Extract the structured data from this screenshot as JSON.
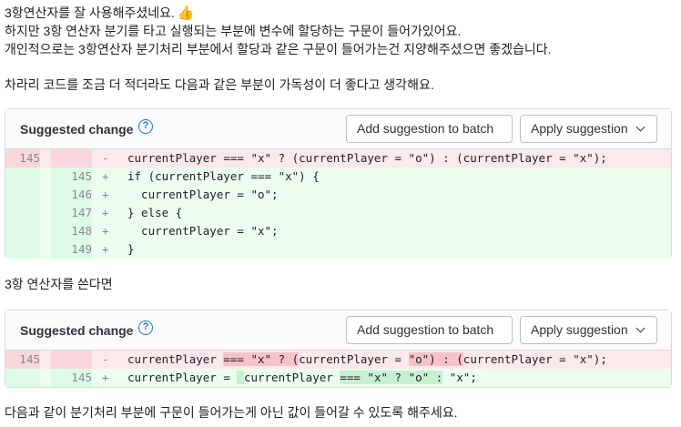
{
  "comment1": {
    "lines": [
      "3항연산자를 잘 사용해주셨네요.",
      "하지만 3항 연산자 분기를 타고 실행되는 부분에 변수에 할당하는 구문이 들어가있어요.",
      "개인적으로는 3항연산자 분기처리 부분에서 할당과 같은 구문이 들어가는건 지양해주셨으면 좋겠습니다.",
      "차라리 코드를 조금 더 적더라도 다음과 같은 부분이 가독성이 더 좋다고 생각해요."
    ],
    "emoji_icon": "thumbs-up-icon"
  },
  "suggestion_ui": {
    "title": "Suggested change",
    "help_label": "?",
    "add_batch_label": "Add suggestion to batch",
    "apply_label": "Apply suggestion"
  },
  "suggestion1": {
    "old_line": {
      "num": "145",
      "sign": "-",
      "code": "currentPlayer === \"x\" ? (currentPlayer = \"o\") : (currentPlayer = \"x\");"
    },
    "new_lines": [
      {
        "num": "145",
        "sign": "+",
        "code": "if (currentPlayer === \"x\") {"
      },
      {
        "num": "146",
        "sign": "+",
        "code": "  currentPlayer = \"o\";"
      },
      {
        "num": "147",
        "sign": "+",
        "code": "} else {"
      },
      {
        "num": "148",
        "sign": "+",
        "code": "  currentPlayer = \"x\";"
      },
      {
        "num": "149",
        "sign": "+",
        "code": "}"
      }
    ]
  },
  "comment2": {
    "text": "3항 연산자를 쓴다면"
  },
  "suggestion2": {
    "old_line": {
      "num": "145",
      "sign": "-",
      "parts": [
        "currentPlayer ",
        "=== \"x\" ? (",
        "currentPlayer = ",
        "\"o\") : (",
        "currentPlayer = ",
        "\"x\")",
        ";"
      ]
    },
    "new_line": {
      "num": "145",
      "sign": "+",
      "parts": [
        "currentPlayer = ",
        " ",
        "currentPlayer ",
        "===",
        " \"x\" ? \"o\" ",
        ":",
        " \"x\";"
      ]
    }
  },
  "comment3": {
    "text": "다음과 같이 분기처리 부분에 구문이 들어가는게 아닌 값이 들어갈 수 있도록 해주세요."
  },
  "colors": {
    "deleted_bg": "#fbe9eb",
    "added_bg": "#ecfdf0",
    "link_blue": "#1f75cb"
  }
}
